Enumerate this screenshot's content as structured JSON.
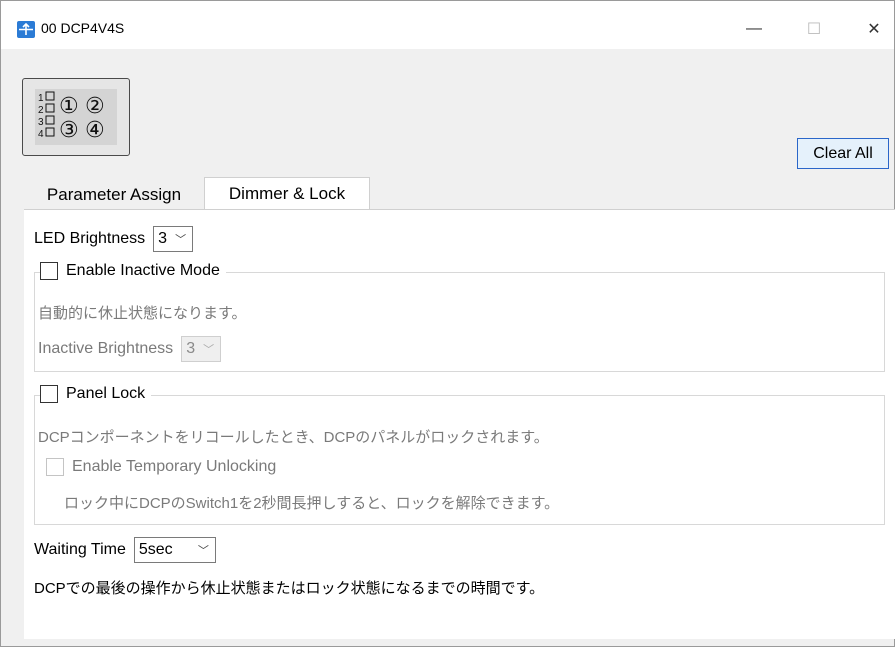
{
  "window": {
    "title": "00 DCP4V4S",
    "minimize_glyph": "—",
    "maximize_glyph": "☐",
    "close_glyph": "✕"
  },
  "device_icon": {
    "rows": [
      "1",
      "2",
      "3",
      "4"
    ],
    "knobs": [
      "①",
      "②",
      "③",
      "④"
    ]
  },
  "toolbar": {
    "clear_all_label": "Clear All"
  },
  "tabs": [
    {
      "label": "Parameter Assign",
      "active": false
    },
    {
      "label": "Dimmer & Lock",
      "active": true
    }
  ],
  "dimmer": {
    "led_brightness_label": "LED Brightness",
    "led_brightness_value": "3",
    "inactive_mode": {
      "label": "Enable Inactive Mode",
      "checked": false,
      "description": "自動的に休止状態になります。",
      "brightness_label": "Inactive Brightness",
      "brightness_value": "3"
    },
    "panel_lock": {
      "label": "Panel Lock",
      "checked": false,
      "description": "DCPコンポーネントをリコールしたとき、DCPのパネルがロックされます。",
      "temp_unlock_label": "Enable Temporary Unlocking",
      "temp_unlock_checked": false,
      "temp_unlock_description": "ロック中にDCPのSwitch1を2秒間長押しすると、ロックを解除できます。"
    },
    "waiting_time_label": "Waiting Time",
    "waiting_time_value": "5sec",
    "waiting_time_description": "DCPでの最後の操作から休止状態またはロック状態になるまでの時間です。"
  },
  "colors": {
    "accent": "#2a66c9",
    "app_icon": "#2b7bd5"
  }
}
